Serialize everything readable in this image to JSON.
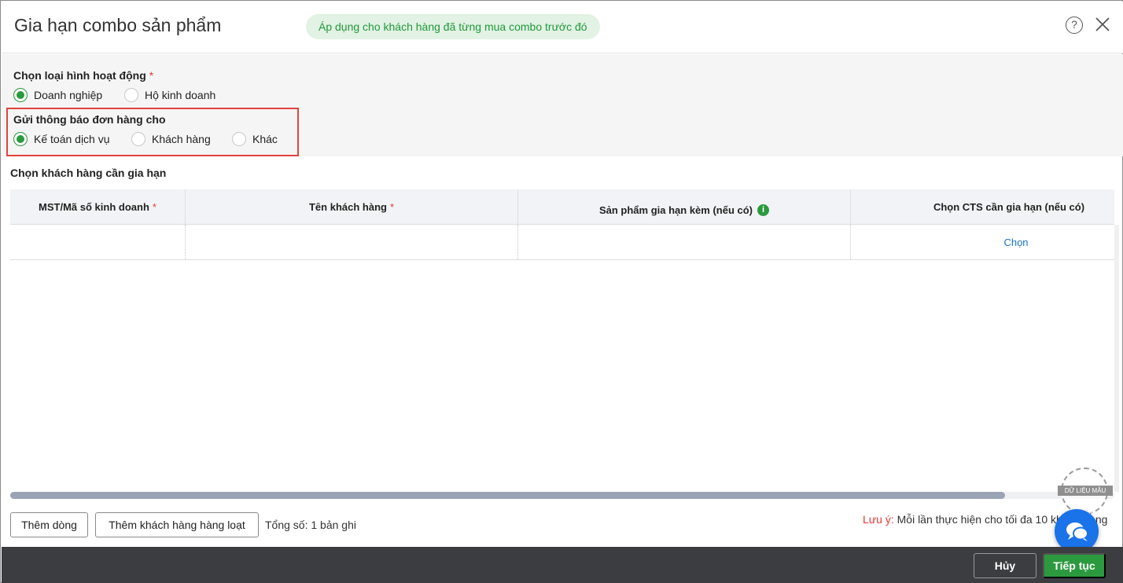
{
  "dialog": {
    "title": "Gia hạn combo sản phẩm",
    "badge": "Áp dụng cho khách hàng đã từng mua combo trước đó",
    "help_icon": "?"
  },
  "business_type": {
    "label": "Chọn loại hình hoạt động",
    "required_mark": "*",
    "options": [
      {
        "label": "Doanh nghiệp",
        "selected": true
      },
      {
        "label": "Hộ kinh doanh",
        "selected": false
      }
    ]
  },
  "notify": {
    "label": "Gửi thông báo đơn hàng cho",
    "options": [
      {
        "label": "Kế toán dịch vụ",
        "selected": true
      },
      {
        "label": "Khách hàng",
        "selected": false
      },
      {
        "label": "Khác",
        "selected": false
      }
    ]
  },
  "customers": {
    "section_title": "Chọn khách hàng cần gia hạn",
    "columns": [
      {
        "label": "MST/Mã số kinh doanh",
        "required": "*"
      },
      {
        "label": "Tên khách hàng",
        "required": "*"
      },
      {
        "label": "Sản phẩm gia hạn kèm (nếu có)",
        "info_icon": "i"
      },
      {
        "label": "Chọn CTS cần gia hạn (nếu có)"
      }
    ],
    "rows": [
      {
        "tax_code": "",
        "customer_name": "",
        "extra_product": "",
        "cts_action": "Chọn"
      }
    ],
    "scroll_position": 0
  },
  "actions": {
    "add_row": "Thêm dòng",
    "add_bulk": "Thêm khách hàng hàng loạt",
    "total": "Tổng số: 1 bản ghi"
  },
  "note": {
    "label": "Lưu ý:",
    "text": " Mỗi lần thực hiện cho tối đa 10 khách hàng"
  },
  "watermark": {
    "text": "DỮ LIỆU MẪU"
  },
  "chat": {
    "close": "×"
  },
  "footer": {
    "cancel": "Hủy",
    "next": "Tiếp tục"
  },
  "colors": {
    "accent_green": "#2b9a3e",
    "link_blue": "#1a73c8",
    "highlight_red": "#e0443e",
    "footer_bg": "#3c3d40"
  }
}
